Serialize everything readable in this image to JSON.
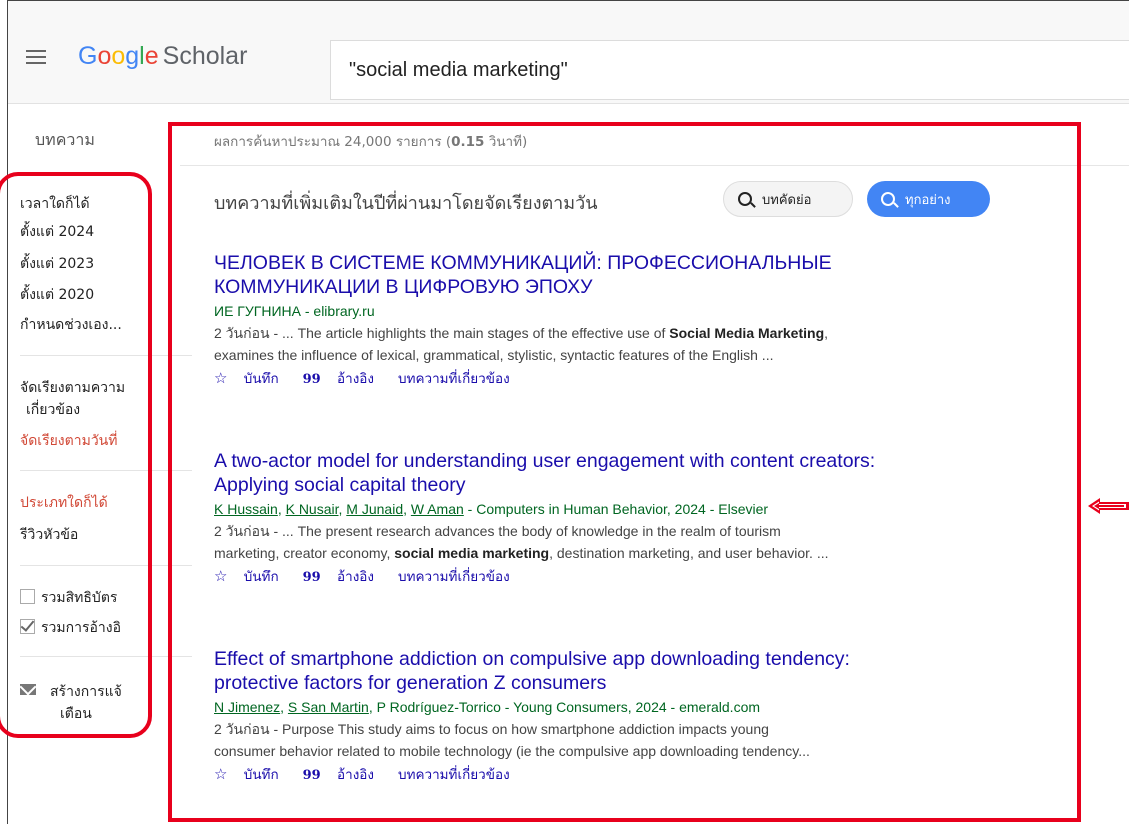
{
  "header": {
    "logo_letters": [
      "G",
      "o",
      "o",
      "g",
      "l",
      "e"
    ],
    "logo_suffix": "Scholar",
    "search_value": "\"social media marketing\""
  },
  "sidebar": {
    "heading": "บทความ",
    "time_items": [
      "เวลาใดก็ได้",
      "ตั้งแต่ 2024",
      "ตั้งแต่ 2023",
      "ตั้งแต่ 2020",
      "กำหนดช่วงเอง..."
    ],
    "sort_relevance": "จัดเรียงตามความ เกี่ยวข้อง",
    "sort_relevance_line1": "จัดเรียงตามความ",
    "sort_relevance_line2": "เกี่ยวข้อง",
    "sort_date": "จัดเรียงตามวันที่",
    "type_any": "ประเภทใดก็ได้",
    "type_review": "รีวิวหัวข้อ",
    "include_patents": "รวมสิทธิบัตร",
    "include_citations": "รวมการอ้างอิ",
    "create_alert_line1": "สร้างการแจ้",
    "create_alert_line2": "เตือน"
  },
  "results_summary": {
    "prefix": "ผลการค้นหาประมาณ 24,000 รายการ (",
    "time": "0.15",
    "suffix": " วินาที)"
  },
  "recent": {
    "title": "บทความที่เพิ่มเติมในปีที่ผ่านมาโดยจัดเรียงตามวัน",
    "chip_abstract": "บทคัดย่อ",
    "chip_everything": "ทุกอย่าง"
  },
  "result_links": {
    "save": "บันทึก",
    "cite_glyph": "99",
    "cite": "อ้างอิง",
    "related": "บทความที่เกี่ยวข้อง"
  },
  "results": [
    {
      "title_line1": "ЧЕЛОВЕК В СИСТЕМЕ КОММУНИКАЦИЙ: ПРОФЕССИОНАЛЬНЫЕ",
      "title_line2": "КОММУНИКАЦИИ В ЦИФРОВУЮ ЭПОХУ",
      "authors_plain": "ИЕ ГУГНИНА - elibrary.ru",
      "snippet_a": "2 วันก่อน - ... The article highlights the main stages of the effective use of ",
      "snippet_bold": "Social Media Marketing",
      "snippet_b": ",",
      "snippet_line2": "examines the influence of lexical, grammatical, stylistic, syntactic features of the English ..."
    },
    {
      "title_line1": "A two-actor model for understanding user engagement with content creators:",
      "title_line2": "Applying social capital theory",
      "author_links": [
        "K Hussain",
        "K Nusair",
        "M Junaid",
        "W Aman"
      ],
      "authors_rest": " - Computers in Human Behavior, 2024 - Elsevier",
      "snippet_line1": "2 วันก่อน - ... The present research advances the body of knowledge in the realm of tourism",
      "snippet_a": "marketing, creator economy, ",
      "snippet_bold": "social media marketing",
      "snippet_b": ", destination marketing, and user behavior. ..."
    },
    {
      "title_line1": "Effect of smartphone addiction on compulsive app downloading tendency:",
      "title_line2": "protective factors for generation Z consumers",
      "author_links": [
        "N Jimenez",
        "S San Martin"
      ],
      "authors_rest": ", P Rodríguez-Torrico - Young Consumers, 2024 - emerald.com",
      "snippet_line1": "2 วันก่อน - Purpose This study aims to focus on how smartphone addiction impacts young",
      "snippet_line2": "consumer behavior related to mobile technology (ie the compulsive app downloading tendency..."
    }
  ],
  "colors": {
    "annotation_red": "#e8001c",
    "link_blue": "#1a0dab",
    "author_green": "#006621",
    "chip_blue": "#4285f4"
  }
}
